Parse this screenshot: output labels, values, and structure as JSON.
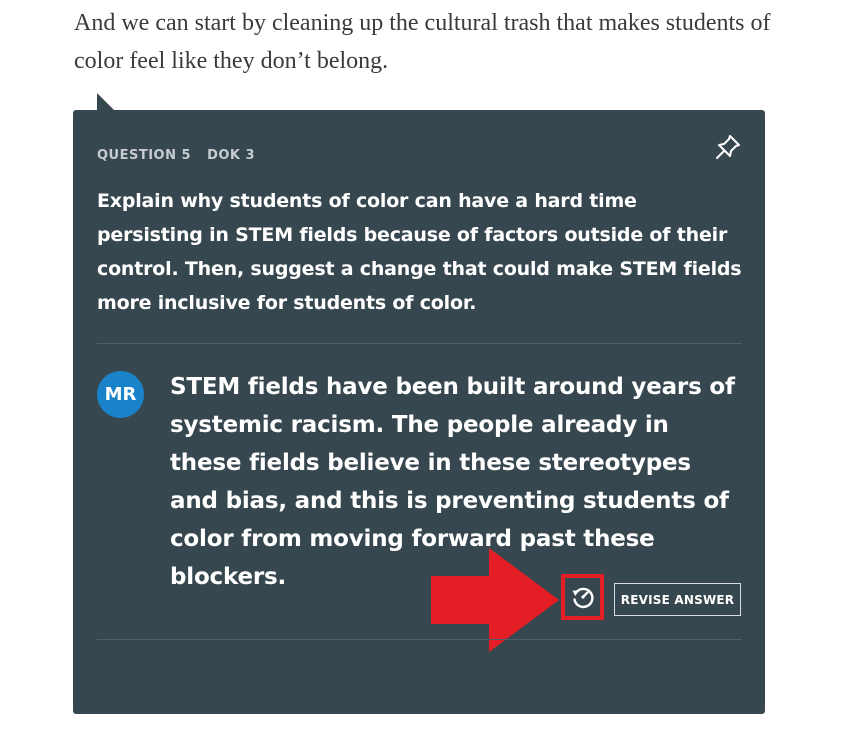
{
  "article": {
    "text": "And we can start by cleaning up the cultural trash that makes students of color feel like they don’t belong."
  },
  "question_card": {
    "question_label": "QUESTION 5",
    "dok_label": "DOK 3",
    "pin_icon": "pushpin-icon",
    "question_text": "Explain why students of color can have a hard time persisting in STEM fields because of factors outside of their control. Then, suggest a change that could make STEM fields more inclusive for students of color.",
    "answer": {
      "avatar_initials": "MR",
      "avatar_color": "#1a82c8",
      "text": "STEM fields have been built around years of systemic racism. The people already in these fields believe in these stereotypes and bias, and this is preventing students of color from moving forward past these blockers."
    },
    "history_icon": "revision-history-icon",
    "revise_button_label": "REVISE ANSWER"
  },
  "colors": {
    "card_background": "#37474f",
    "annotation_red": "#e31e24",
    "article_text": "#3a3a3a"
  }
}
